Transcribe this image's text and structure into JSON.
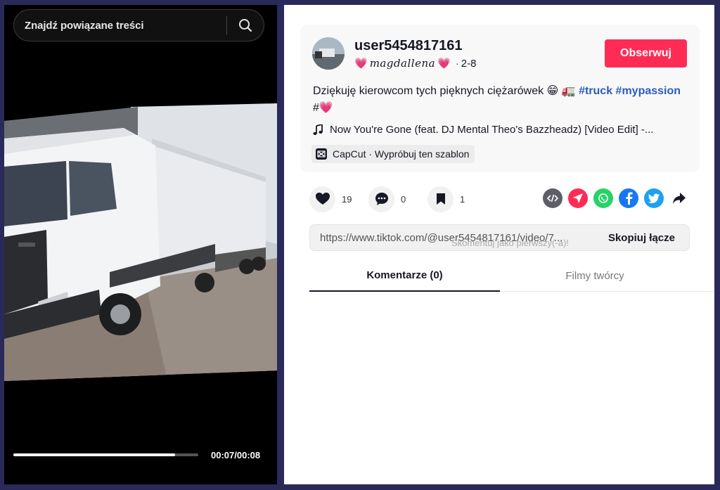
{
  "search": {
    "placeholder": "Znajdź powiązane treści"
  },
  "player": {
    "time": "00:07/00:08",
    "progress": 0.875
  },
  "author": {
    "username": "user5454817161",
    "nickname": "magdallena",
    "date": "2-8"
  },
  "follow_label": "Obserwuj",
  "description": {
    "text": "Dziękuję kierowcom tych pięknych ciężarówek 😁 🚛 ",
    "tag1": "#truck",
    "tag2": "#mypassion",
    "tail": " #"
  },
  "music": {
    "title": "Now You're Gone (feat. DJ Mental Theo's Bazzheadz) [Video Edit] -..."
  },
  "capcut": {
    "label": "CapCut · Wypróbuj ten szablon"
  },
  "actions": {
    "likes": "19",
    "comments": "0",
    "saves": "1"
  },
  "share_icons": [
    "embed-icon",
    "send-icon",
    "whatsapp-icon",
    "facebook-icon",
    "twitter-icon",
    "share-arrow-icon"
  ],
  "colors": {
    "accent": "#fe2c55",
    "hashtag": "#2b5db9",
    "whatsapp": "#25d366",
    "facebook": "#1877f2",
    "twitter": "#1da1f2"
  },
  "link": {
    "url": "https://www.tiktok.com/@user5454817161/video/7...",
    "copy_label": "Skopiuj łącze",
    "comment_hint": "Skomentuj jako pierwszy(-a)!"
  },
  "tabs": {
    "comments": "Komentarze (0)",
    "creator_videos": "Filmy twórcy"
  }
}
